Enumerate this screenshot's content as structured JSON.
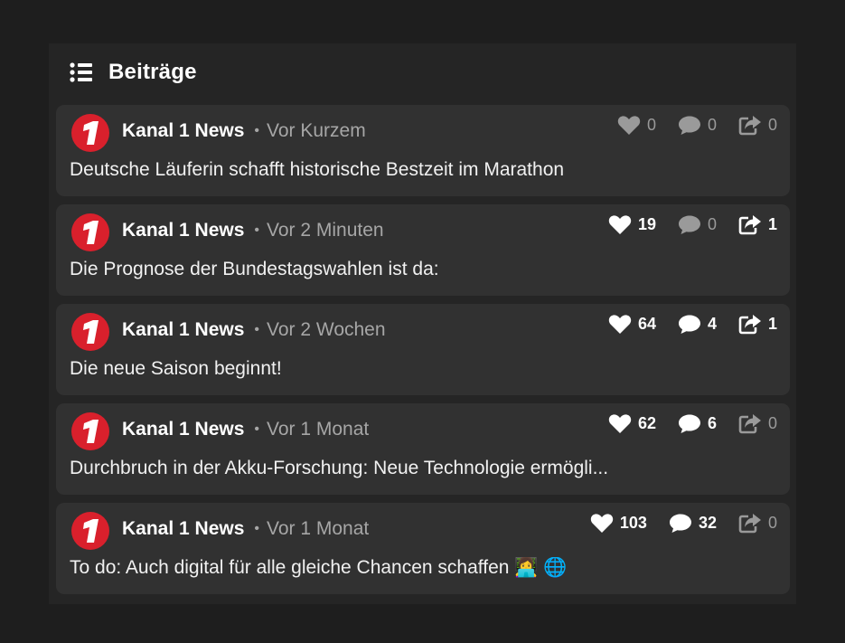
{
  "header": {
    "title": "Beiträge",
    "icon": "list-icon"
  },
  "posts": [
    {
      "channel": "Kanal 1 News",
      "time": "Vor Kurzem",
      "text": "Deutsche Läuferin schafft historische Bestzeit im Marathon",
      "likes": "0",
      "comments": "0",
      "shares": "0"
    },
    {
      "channel": "Kanal 1 News",
      "time": "Vor 2 Minuten",
      "text": "Die Prognose der Bundestagswahlen ist da:",
      "likes": "19",
      "comments": "0",
      "shares": "1"
    },
    {
      "channel": "Kanal 1 News",
      "time": "Vor 2 Wochen",
      "text": "Die neue Saison beginnt!",
      "likes": "64",
      "comments": "4",
      "shares": "1"
    },
    {
      "channel": "Kanal 1 News",
      "time": "Vor 1 Monat",
      "text": "Durchbruch in der Akku-Forschung: Neue Technologie ermögli...",
      "likes": "62",
      "comments": "6",
      "shares": "0"
    },
    {
      "channel": "Kanal 1 News",
      "time": "Vor 1 Monat",
      "text": "To do: Auch digital für alle gleiche Chancen schaffen 👩‍💻 🌐",
      "likes": "103",
      "comments": "32",
      "shares": "0"
    }
  ],
  "colors": {
    "background": "#1e1e1e",
    "panel": "#252525",
    "card": "#313131",
    "brand": "#d9202c",
    "muted": "#a6a6a6"
  },
  "logo": {
    "glyph": "1"
  }
}
